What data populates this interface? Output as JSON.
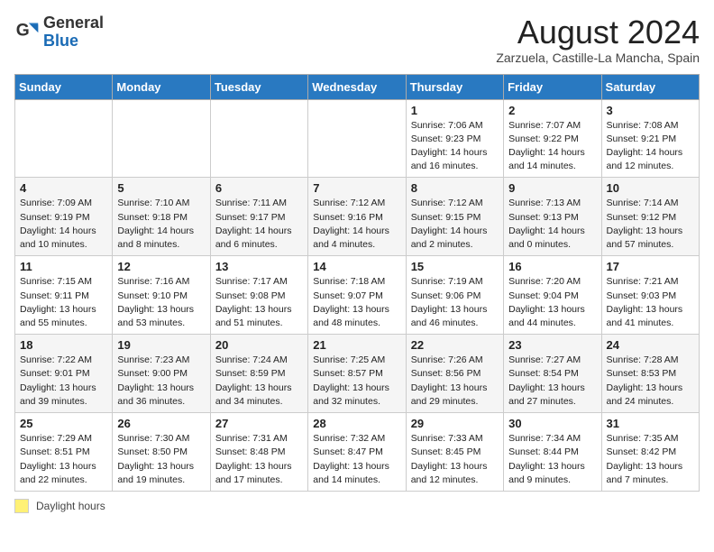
{
  "header": {
    "logo_general": "General",
    "logo_blue": "Blue",
    "month_title": "August 2024",
    "subtitle": "Zarzuela, Castille-La Mancha, Spain"
  },
  "calendar": {
    "days_of_week": [
      "Sunday",
      "Monday",
      "Tuesday",
      "Wednesday",
      "Thursday",
      "Friday",
      "Saturday"
    ],
    "weeks": [
      [
        {
          "day": "",
          "info": ""
        },
        {
          "day": "",
          "info": ""
        },
        {
          "day": "",
          "info": ""
        },
        {
          "day": "",
          "info": ""
        },
        {
          "day": "1",
          "info": "Sunrise: 7:06 AM\nSunset: 9:23 PM\nDaylight: 14 hours\nand 16 minutes."
        },
        {
          "day": "2",
          "info": "Sunrise: 7:07 AM\nSunset: 9:22 PM\nDaylight: 14 hours\nand 14 minutes."
        },
        {
          "day": "3",
          "info": "Sunrise: 7:08 AM\nSunset: 9:21 PM\nDaylight: 14 hours\nand 12 minutes."
        }
      ],
      [
        {
          "day": "4",
          "info": "Sunrise: 7:09 AM\nSunset: 9:19 PM\nDaylight: 14 hours\nand 10 minutes."
        },
        {
          "day": "5",
          "info": "Sunrise: 7:10 AM\nSunset: 9:18 PM\nDaylight: 14 hours\nand 8 minutes."
        },
        {
          "day": "6",
          "info": "Sunrise: 7:11 AM\nSunset: 9:17 PM\nDaylight: 14 hours\nand 6 minutes."
        },
        {
          "day": "7",
          "info": "Sunrise: 7:12 AM\nSunset: 9:16 PM\nDaylight: 14 hours\nand 4 minutes."
        },
        {
          "day": "8",
          "info": "Sunrise: 7:12 AM\nSunset: 9:15 PM\nDaylight: 14 hours\nand 2 minutes."
        },
        {
          "day": "9",
          "info": "Sunrise: 7:13 AM\nSunset: 9:13 PM\nDaylight: 14 hours\nand 0 minutes."
        },
        {
          "day": "10",
          "info": "Sunrise: 7:14 AM\nSunset: 9:12 PM\nDaylight: 13 hours\nand 57 minutes."
        }
      ],
      [
        {
          "day": "11",
          "info": "Sunrise: 7:15 AM\nSunset: 9:11 PM\nDaylight: 13 hours\nand 55 minutes."
        },
        {
          "day": "12",
          "info": "Sunrise: 7:16 AM\nSunset: 9:10 PM\nDaylight: 13 hours\nand 53 minutes."
        },
        {
          "day": "13",
          "info": "Sunrise: 7:17 AM\nSunset: 9:08 PM\nDaylight: 13 hours\nand 51 minutes."
        },
        {
          "day": "14",
          "info": "Sunrise: 7:18 AM\nSunset: 9:07 PM\nDaylight: 13 hours\nand 48 minutes."
        },
        {
          "day": "15",
          "info": "Sunrise: 7:19 AM\nSunset: 9:06 PM\nDaylight: 13 hours\nand 46 minutes."
        },
        {
          "day": "16",
          "info": "Sunrise: 7:20 AM\nSunset: 9:04 PM\nDaylight: 13 hours\nand 44 minutes."
        },
        {
          "day": "17",
          "info": "Sunrise: 7:21 AM\nSunset: 9:03 PM\nDaylight: 13 hours\nand 41 minutes."
        }
      ],
      [
        {
          "day": "18",
          "info": "Sunrise: 7:22 AM\nSunset: 9:01 PM\nDaylight: 13 hours\nand 39 minutes."
        },
        {
          "day": "19",
          "info": "Sunrise: 7:23 AM\nSunset: 9:00 PM\nDaylight: 13 hours\nand 36 minutes."
        },
        {
          "day": "20",
          "info": "Sunrise: 7:24 AM\nSunset: 8:59 PM\nDaylight: 13 hours\nand 34 minutes."
        },
        {
          "day": "21",
          "info": "Sunrise: 7:25 AM\nSunset: 8:57 PM\nDaylight: 13 hours\nand 32 minutes."
        },
        {
          "day": "22",
          "info": "Sunrise: 7:26 AM\nSunset: 8:56 PM\nDaylight: 13 hours\nand 29 minutes."
        },
        {
          "day": "23",
          "info": "Sunrise: 7:27 AM\nSunset: 8:54 PM\nDaylight: 13 hours\nand 27 minutes."
        },
        {
          "day": "24",
          "info": "Sunrise: 7:28 AM\nSunset: 8:53 PM\nDaylight: 13 hours\nand 24 minutes."
        }
      ],
      [
        {
          "day": "25",
          "info": "Sunrise: 7:29 AM\nSunset: 8:51 PM\nDaylight: 13 hours\nand 22 minutes."
        },
        {
          "day": "26",
          "info": "Sunrise: 7:30 AM\nSunset: 8:50 PM\nDaylight: 13 hours\nand 19 minutes."
        },
        {
          "day": "27",
          "info": "Sunrise: 7:31 AM\nSunset: 8:48 PM\nDaylight: 13 hours\nand 17 minutes."
        },
        {
          "day": "28",
          "info": "Sunrise: 7:32 AM\nSunset: 8:47 PM\nDaylight: 13 hours\nand 14 minutes."
        },
        {
          "day": "29",
          "info": "Sunrise: 7:33 AM\nSunset: 8:45 PM\nDaylight: 13 hours\nand 12 minutes."
        },
        {
          "day": "30",
          "info": "Sunrise: 7:34 AM\nSunset: 8:44 PM\nDaylight: 13 hours\nand 9 minutes."
        },
        {
          "day": "31",
          "info": "Sunrise: 7:35 AM\nSunset: 8:42 PM\nDaylight: 13 hours\nand 7 minutes."
        }
      ]
    ]
  },
  "footer": {
    "swatch_label": "Daylight hours"
  }
}
